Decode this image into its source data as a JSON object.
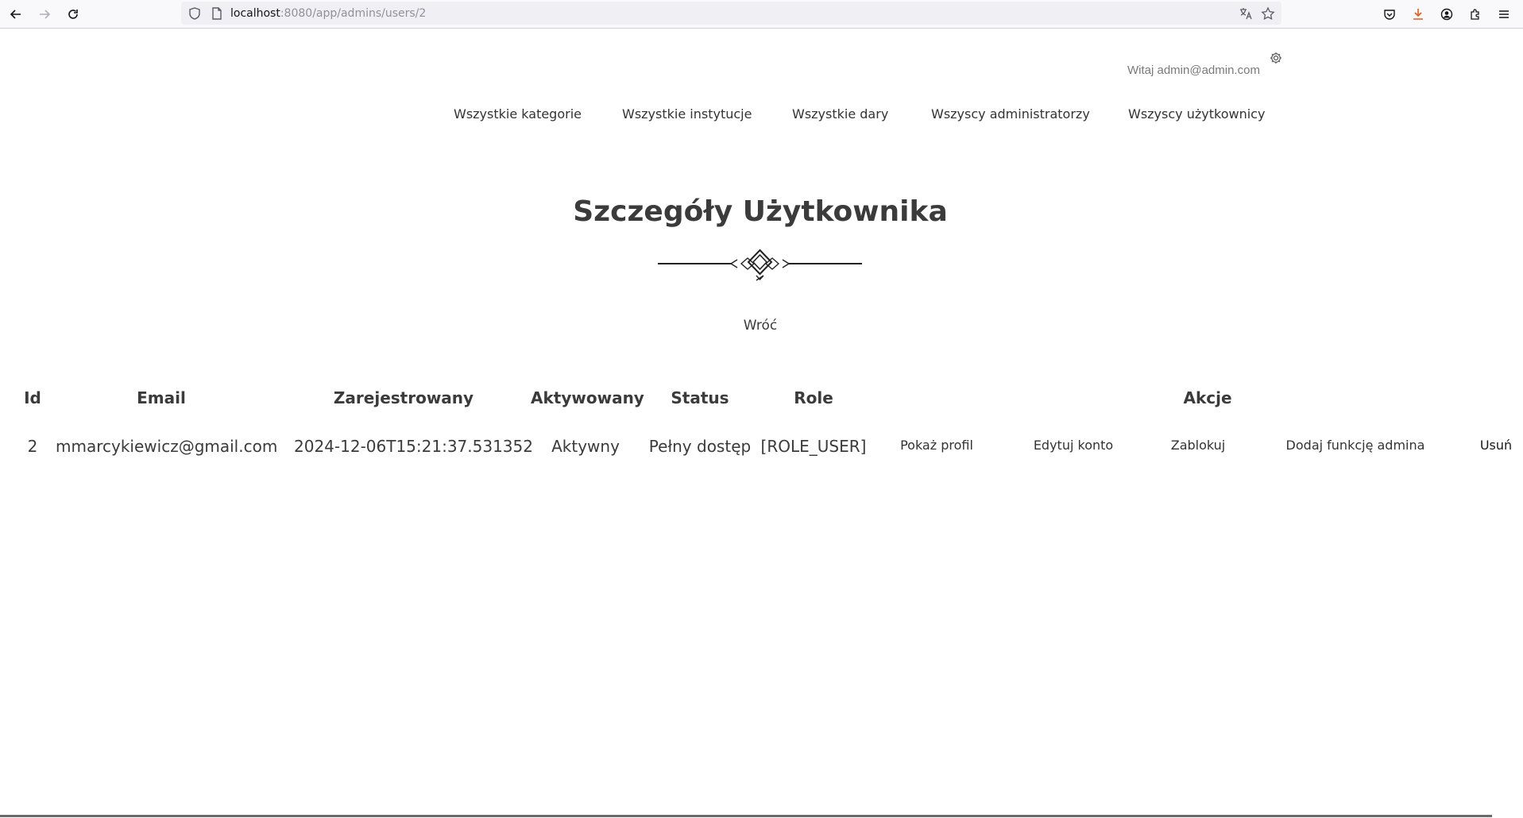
{
  "browser": {
    "url_host": "localhost",
    "url_path": ":8080/app/admins/users/2"
  },
  "header": {
    "greeting": "Witaj admin@admin.com"
  },
  "nav": {
    "items": [
      {
        "label": "Wszystkie kategorie"
      },
      {
        "label": "Wszystkie instytucje"
      },
      {
        "label": "Wszystkie dary"
      },
      {
        "label": "Wszyscy administratorzy"
      },
      {
        "label": "Wszyscy użytkownicy"
      }
    ]
  },
  "main": {
    "title": "Szczegóły Użytkownika",
    "back_label": "Wróć"
  },
  "table": {
    "headers": {
      "id": "Id",
      "email": "Email",
      "registered": "Zarejestrowany",
      "activated": "Aktywowany",
      "status": "Status",
      "role": "Role",
      "actions": "Akcje"
    },
    "row": {
      "id": "2",
      "email": "mmarcykiewicz@gmail.com",
      "registered": "2024-12-06T15:21:37.531352",
      "activated": "Aktywny",
      "status": "Pełny dostęp",
      "role": "[ROLE_USER]"
    },
    "actions": {
      "show_profile": "Pokaż profil",
      "edit_account": "Edytuj konto",
      "block": "Zablokuj",
      "add_admin": "Dodaj funkcję admina",
      "delete": "Usuń"
    }
  },
  "colors": {
    "download_icon": "#e55b1b"
  }
}
